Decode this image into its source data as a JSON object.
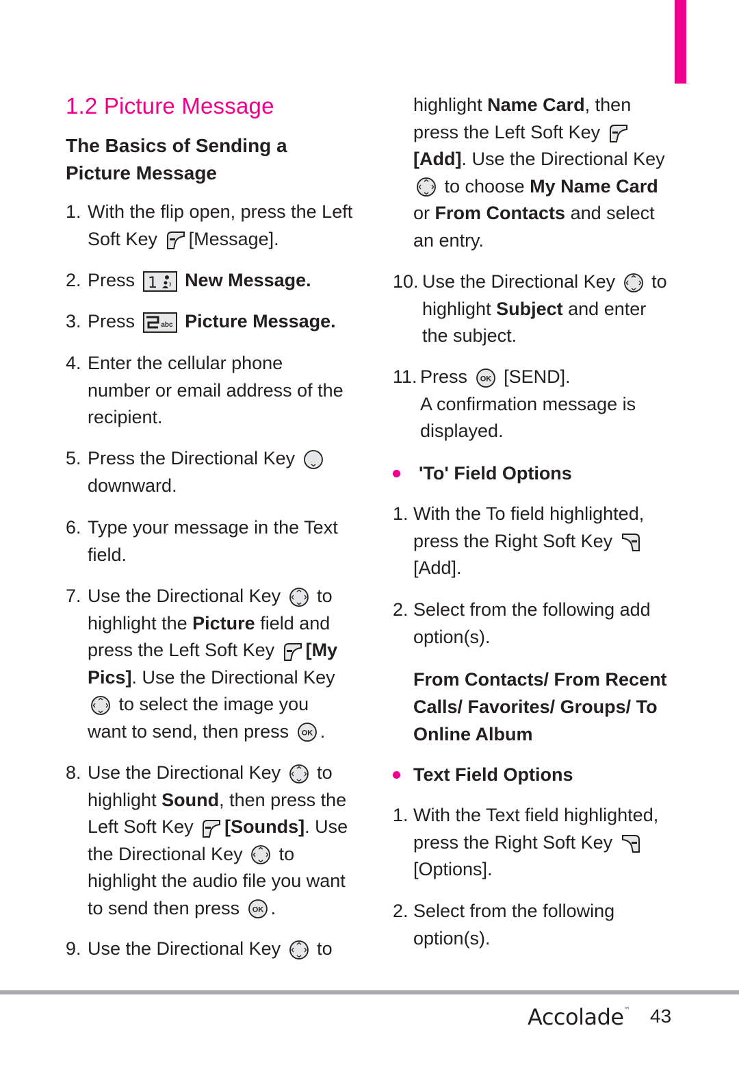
{
  "page": {
    "section_number_title": "1.2 Picture Message",
    "subtitle": "The Basics of Sending a Picture Message",
    "accent_color": "#ec008c",
    "footer": {
      "brand": "Accolade",
      "trademark": "™",
      "page_number": "43"
    }
  },
  "left_steps": [
    {
      "num": "1.",
      "parts": [
        "With the flip open, press the Left Soft Key",
        "[Message]."
      ]
    },
    {
      "num": "2.",
      "parts": [
        "Press",
        "New Message."
      ]
    },
    {
      "num": "3.",
      "parts": [
        "Press",
        "Picture Message."
      ]
    },
    {
      "num": "4.",
      "parts": [
        "Enter the cellular phone number or email address of the recipient."
      ]
    },
    {
      "num": "5.",
      "parts": [
        "Press the Directional Key",
        "downward."
      ]
    },
    {
      "num": "6.",
      "parts": [
        "Type your message in the Text field."
      ]
    },
    {
      "num": "7.",
      "parts": [
        "Use the Directional Key",
        "to highlight the",
        "Picture",
        "field and press the Left Soft Key",
        "[My Pics]",
        ". Use the Directional Key",
        "to select the image you want to send, then press",
        "."
      ]
    },
    {
      "num": "8.",
      "parts": [
        "Use the Directional Key",
        "to highlight",
        "Sound",
        ", then press the Left Soft Key",
        "[Sounds]",
        ". Use the Directional Key",
        "to highlight the audio file you want to send then press",
        "."
      ]
    },
    {
      "num": "9.",
      "parts": [
        "Use the Directional Key",
        "to"
      ]
    }
  ],
  "right_steps": [
    {
      "num": "",
      "parts": [
        "highlight",
        "Name Card",
        ", then press the Left Soft  Key",
        "[Add]",
        ". Use the Directional Key",
        "to choose",
        "My Name Card",
        "or",
        "From Contacts",
        "and select an entry."
      ]
    },
    {
      "num": "10.",
      "parts": [
        "Use the Directional Key",
        "to highlight",
        "Subject",
        "and enter the subject."
      ]
    },
    {
      "num": "11.",
      "parts": [
        "Press",
        "[SEND].",
        "A confirmation message is displayed."
      ]
    }
  ],
  "to_field": {
    "heading": "'To' Field Options",
    "steps": [
      {
        "num": "1.",
        "parts": [
          "With the To field highlighted, press the Right Soft Key",
          "[Add]."
        ]
      },
      {
        "num": "2.",
        "parts": [
          "Select from the following add option(s)."
        ]
      }
    ],
    "options": "From Contacts/ From Recent Calls/ Favorites/ Groups/ To Online Album"
  },
  "text_field": {
    "heading": "Text Field Options",
    "steps": [
      {
        "num": "1.",
        "parts": [
          "With the Text field highlighted, press the Right Soft Key",
          "[Options]."
        ]
      },
      {
        "num": "2.",
        "parts": [
          "Select from the following option(s)."
        ]
      }
    ]
  },
  "icons": {
    "left_soft_key": "left-soft-key-icon",
    "right_soft_key": "right-soft-key-icon",
    "directional_key": "directional-key-icon",
    "ok_key": "ok-key-icon",
    "key_1": "key-1-icon",
    "key_2": "key-2-abc-icon",
    "key_1_label": "1",
    "key_2_label": "2",
    "key_2_sub": "abc",
    "ok_label": "OK"
  }
}
